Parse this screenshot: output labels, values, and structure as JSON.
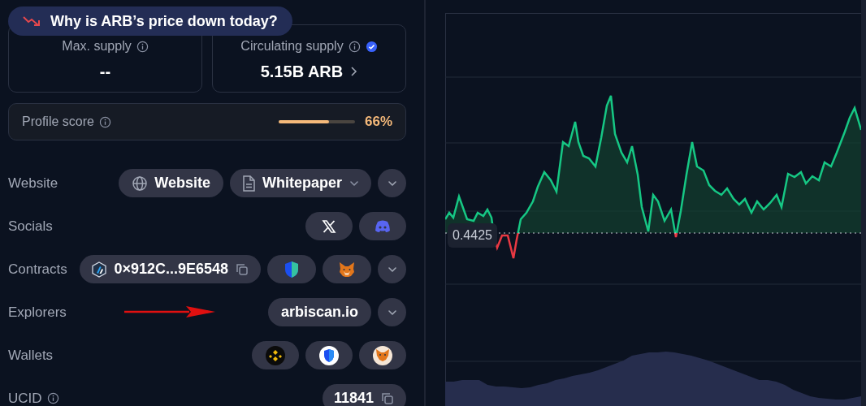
{
  "price_banner": {
    "text": "Why is ARB’s price down today?"
  },
  "stats": [
    {
      "label": "Max. supply",
      "value": "--",
      "verified": false,
      "has_link": false
    },
    {
      "label": "Circulating supply",
      "value": "5.15B ARB",
      "verified": true,
      "has_link": true
    }
  ],
  "profile_score": {
    "label": "Profile score",
    "level": 0.66,
    "value": "66%"
  },
  "link_rows": [
    {
      "label": "Website",
      "info": false,
      "items": [
        {
          "kind": "website",
          "text": "Website"
        },
        {
          "kind": "whitepaper",
          "text": "Whitepaper"
        },
        {
          "kind": "more"
        }
      ]
    },
    {
      "label": "Socials",
      "info": false,
      "items": [
        {
          "kind": "x"
        },
        {
          "kind": "discord"
        }
      ]
    },
    {
      "label": "Contracts",
      "info": false,
      "items": [
        {
          "kind": "contract",
          "text": "0×912C...9E6548"
        },
        {
          "kind": "shield"
        },
        {
          "kind": "fox"
        },
        {
          "kind": "more"
        }
      ]
    },
    {
      "label": "Explorers",
      "info": false,
      "items": [
        {
          "kind": "plain",
          "text": "arbiscan.io"
        },
        {
          "kind": "more"
        }
      ]
    },
    {
      "label": "Wallets",
      "info": false,
      "items": [
        {
          "kind": "binance"
        },
        {
          "kind": "shield_round"
        },
        {
          "kind": "fox_round"
        }
      ]
    },
    {
      "label": "UCID",
      "info": true,
      "items": [
        {
          "kind": "copy_text",
          "text": "11841"
        }
      ]
    }
  ],
  "chart": {
    "price_label": "0.4425"
  }
}
